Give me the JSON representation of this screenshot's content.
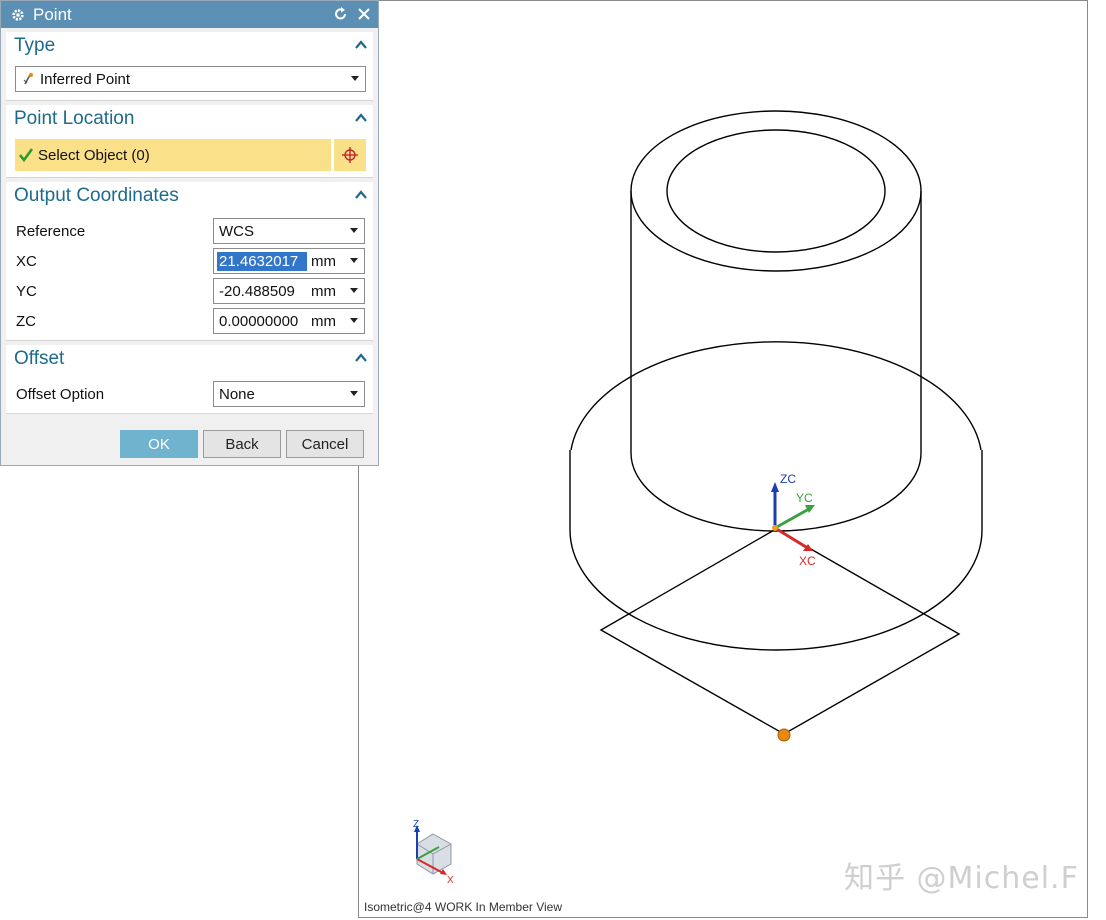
{
  "dialog": {
    "title": "Point",
    "icons": {
      "settings": "gear-icon",
      "reset": "reset-icon",
      "close": "close-icon"
    },
    "type_group": {
      "header": "Type",
      "selected": "Inferred Point",
      "icon": "inferred-point-icon"
    },
    "location_group": {
      "header": "Point Location",
      "select_label": "Select Object (0)",
      "check_icon": "checkmark-icon",
      "point_dialog_icon": "crosshair-icon",
      "highlight_color": "#fbe08a"
    },
    "coords_group": {
      "header": "Output Coordinates",
      "reference_label": "Reference",
      "reference_value": "WCS",
      "xc_label": "XC",
      "xc_value": "21.4632017",
      "yc_label": "YC",
      "yc_value": "-20.488509",
      "zc_label": "ZC",
      "zc_value": "0.00000000",
      "unit": "mm"
    },
    "offset_group": {
      "header": "Offset",
      "option_label": "Offset Option",
      "option_value": "None"
    },
    "buttons": {
      "ok": "OK",
      "back": "Back",
      "cancel": "Cancel"
    },
    "accent_color": "#5b8fb3"
  },
  "viewport": {
    "wcs_labels": {
      "z": "ZC",
      "y": "YC",
      "x": "XC"
    },
    "triad_labels": {
      "z": "Z",
      "x": "X"
    },
    "status": "Isometric@4 WORK In Member View",
    "watermark": "知乎 @Michel.F",
    "axis_colors": {
      "x": "#d42a2a",
      "y": "#3aa040",
      "z": "#1a3fb0"
    },
    "point_color": "#e8890c"
  }
}
